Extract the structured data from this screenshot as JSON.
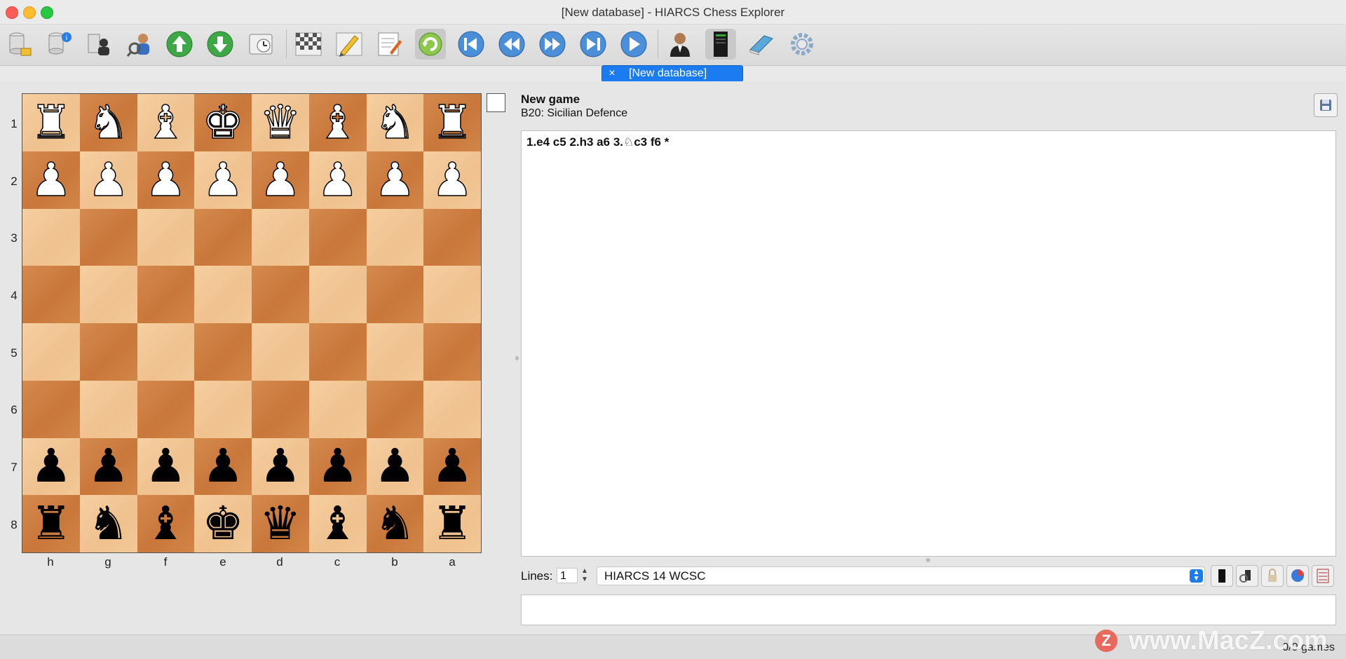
{
  "window": {
    "title": "[New database] - HIARCS Chess Explorer"
  },
  "toolbar": {
    "icons": [
      "open-database-icon",
      "database-info-icon",
      "player-database-icon",
      "search-player-icon",
      "arrow-up-icon",
      "arrow-down-icon",
      "clock-icon",
      "board-setup-icon",
      "edit-pencil-icon",
      "notes-icon",
      "flip-board-icon",
      "first-move-icon",
      "previous-move-icon",
      "next-move-icon",
      "last-move-icon",
      "play-icon",
      "player-icon",
      "engine-computer-icon",
      "book-icon",
      "settings-gear-icon"
    ]
  },
  "database_tab": {
    "close": "×",
    "label": "[New database]"
  },
  "board": {
    "ranks": [
      "1",
      "2",
      "3",
      "4",
      "5",
      "6",
      "7",
      "8"
    ],
    "files": [
      "h",
      "g",
      "f",
      "e",
      "d",
      "c",
      "b",
      "a"
    ],
    "rows": [
      [
        "♜",
        "♞",
        "♝",
        "♚",
        "♛",
        "♝",
        "♞",
        "♜"
      ],
      [
        "♟",
        "♟",
        "♟",
        "♟",
        "♟",
        "♟",
        "♟",
        "♟"
      ],
      [
        "",
        "",
        "",
        "",
        "",
        "",
        "",
        ""
      ],
      [
        "",
        "",
        "",
        "",
        "",
        "",
        "",
        ""
      ],
      [
        "",
        "",
        "",
        "",
        "",
        "",
        "",
        ""
      ],
      [
        "",
        "",
        "",
        "",
        "",
        "",
        "",
        ""
      ],
      [
        "♟",
        "♟",
        "♟",
        "♟",
        "♟",
        "♟",
        "♟",
        "♟"
      ],
      [
        "♜",
        "♞",
        "♝",
        "♚",
        "♛",
        "♝",
        "♞",
        "♜"
      ]
    ]
  },
  "game": {
    "title": "New game",
    "opening": "B20: Sicilian Defence",
    "moves": "1.e4 c5 2.h3 a6 3.♘c3 f6 *"
  },
  "engine_panel": {
    "lines_label": "Lines:",
    "lines_value": "1",
    "engine_name": "HIARCS 14 WCSC"
  },
  "status": {
    "games": "0/0 games"
  },
  "watermark": {
    "text": "www.MacZ.com",
    "badge": "Z"
  }
}
